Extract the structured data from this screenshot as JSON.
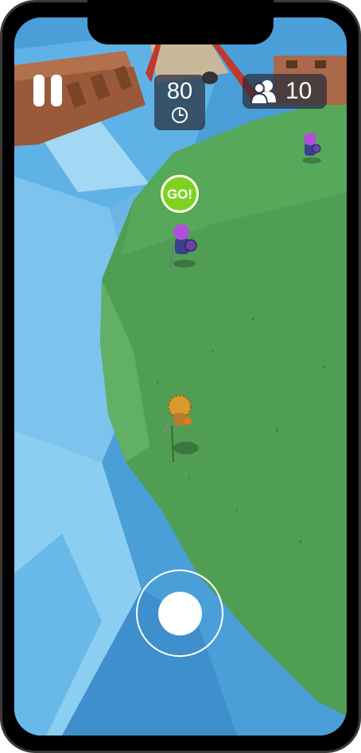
{
  "hud": {
    "timer_value": "80",
    "players_count": "10",
    "go_label": "GO!"
  },
  "icons": {
    "pause": "pause-icon",
    "clock": "clock-icon",
    "players": "players-icon"
  },
  "colors": {
    "water": "#4aa3dd",
    "grass": "#4f9e54",
    "go_badge": "#7ed321",
    "enemy_hat": "#b24fd8",
    "player_body": "#d89a2c"
  }
}
